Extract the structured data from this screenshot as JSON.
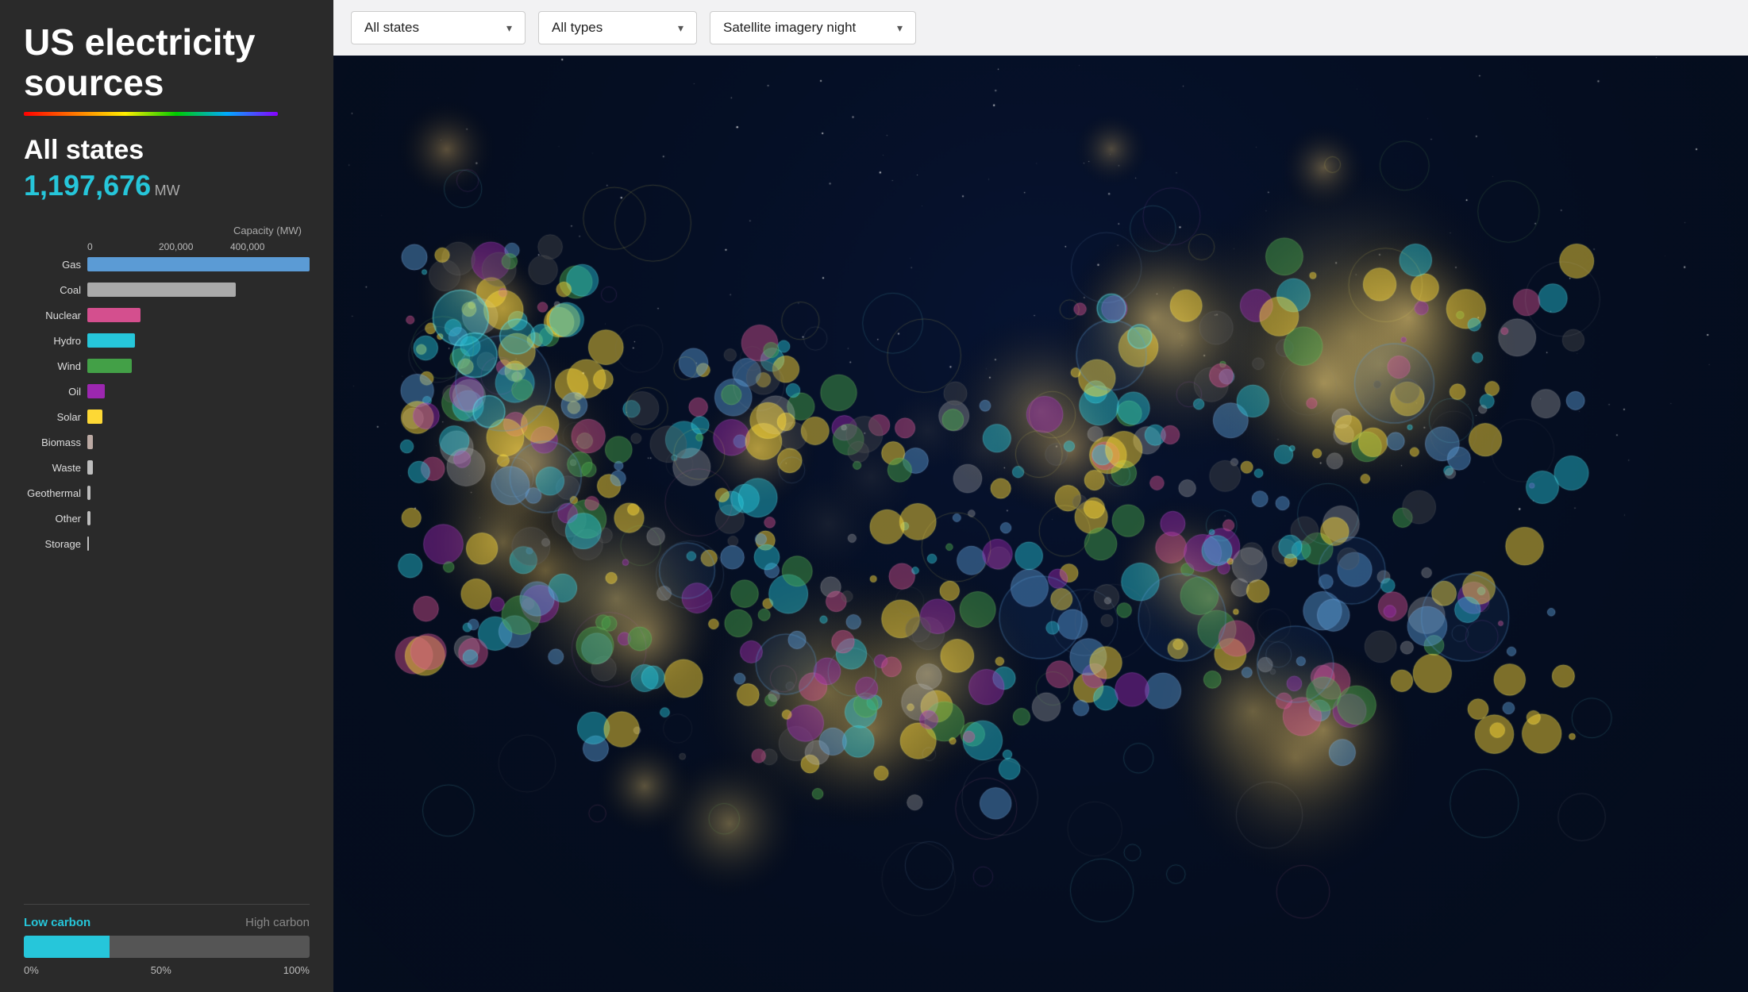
{
  "app": {
    "title": "US electricity sources",
    "rainbow_bar": true
  },
  "left_panel": {
    "state_label": "All states",
    "total_mw": "1,197,676",
    "mw_unit": "MW",
    "capacity_axis_label": "Capacity (MW)",
    "axis_ticks": [
      "0",
      "200,000",
      "400,000"
    ],
    "bars": [
      {
        "label": "Gas",
        "color": "#5b9bd5",
        "pct": 75,
        "width_pct": 75
      },
      {
        "label": "Coal",
        "color": "#aaaaaa",
        "pct": 50,
        "width_pct": 50
      },
      {
        "label": "Nuclear",
        "color": "#d44f8e",
        "pct": 18,
        "width_pct": 18
      },
      {
        "label": "Hydro",
        "color": "#26c6da",
        "pct": 16,
        "width_pct": 16
      },
      {
        "label": "Wind",
        "color": "#43a047",
        "pct": 15,
        "width_pct": 15
      },
      {
        "label": "Oil",
        "color": "#9c27b0",
        "pct": 6,
        "width_pct": 6
      },
      {
        "label": "Solar",
        "color": "#fdd835",
        "pct": 5,
        "width_pct": 5
      },
      {
        "label": "Biomass",
        "color": "#bcaaa4",
        "pct": 2,
        "width_pct": 2
      },
      {
        "label": "Waste",
        "color": "#bdbdbd",
        "pct": 2,
        "width_pct": 2
      },
      {
        "label": "Geothermal",
        "color": "#bdbdbd",
        "pct": 1,
        "width_pct": 1
      },
      {
        "label": "Other",
        "color": "#bdbdbd",
        "pct": 1,
        "width_pct": 1
      },
      {
        "label": "Storage",
        "color": "#bdbdbd",
        "pct": 0.5,
        "width_pct": 0.5
      }
    ],
    "carbon": {
      "low_carbon_label": "Low carbon",
      "high_carbon_label": "High carbon",
      "low_carbon_pct": 30,
      "pct_labels": [
        "0%",
        "50%",
        "100%"
      ]
    }
  },
  "top_bar": {
    "dropdown1": {
      "label": "All states",
      "chevron": "▾"
    },
    "dropdown2": {
      "label": "All types",
      "chevron": "▾"
    },
    "dropdown3": {
      "label": "Satellite imagery night",
      "chevron": "▾"
    }
  },
  "map": {
    "background": "#050d1e"
  },
  "colors": {
    "gas": "#5b9bd5",
    "coal": "#555555",
    "nuclear": "#d44f8e",
    "hydro": "#26c6da",
    "wind": "#43a047",
    "oil": "#9c27b0",
    "solar": "#fdd835",
    "biomass": "#bcaaa4",
    "other": "#888888"
  }
}
